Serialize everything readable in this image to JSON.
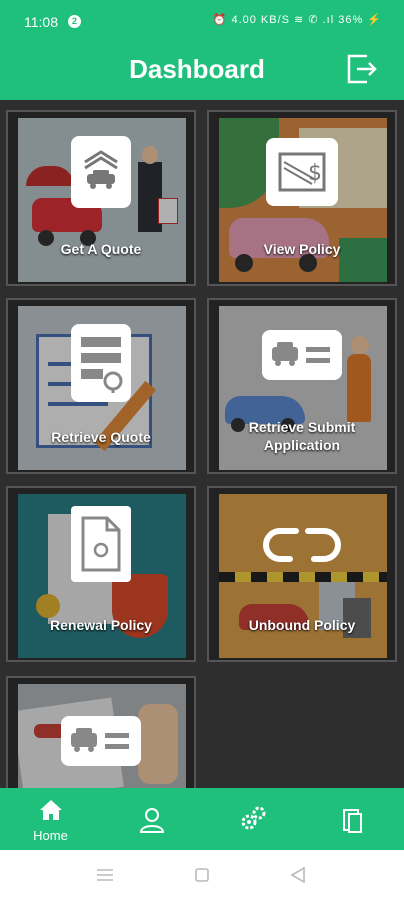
{
  "status": {
    "time": "11:08",
    "notification_count": "2",
    "right_text": "⏰ 4.00 KB/S ≋ ✆ .ıl 36% ⚡"
  },
  "header": {
    "title": "Dashboard"
  },
  "tiles": [
    {
      "label": "Get A Quote"
    },
    {
      "label": "View Policy"
    },
    {
      "label": "Retrieve Quote"
    },
    {
      "label": "Retrieve Submit Application"
    },
    {
      "label": "Renewal Policy"
    },
    {
      "label": "Unbound Policy"
    },
    {
      "label": ""
    }
  ],
  "nav": {
    "home_label": "Home"
  },
  "colors": {
    "primary": "#1fbf7c"
  }
}
